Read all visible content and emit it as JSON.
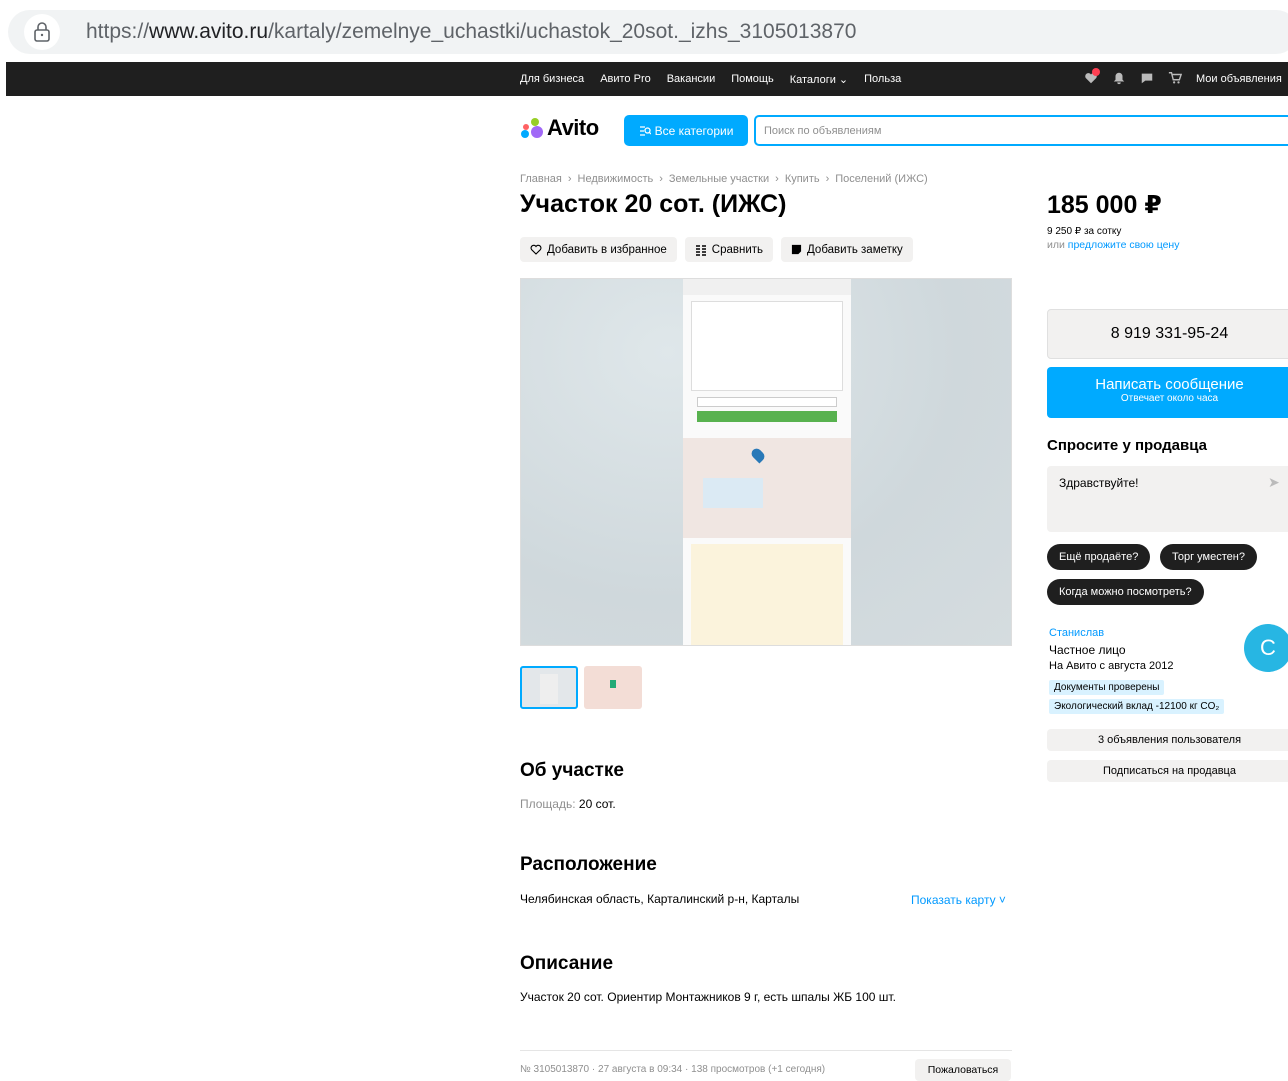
{
  "browser": {
    "url_prefix": "https://",
    "url_domain": "www.avito.ru",
    "url_path": "/kartaly/zemelnye_uchastki/uchastok_20sot._izhs_3105013870"
  },
  "topnav": {
    "items": [
      "Для бизнеса",
      "Авито Pro",
      "Вакансии",
      "Помощь",
      "Каталоги",
      "Польза"
    ],
    "my_ads": "Мои объявления"
  },
  "header": {
    "logo_text": "Avito",
    "all_categories": "Все категории",
    "search_placeholder": "Поиск по объявлениям"
  },
  "breadcrumb": [
    "Главная",
    "Недвижимость",
    "Земельные участки",
    "Купить",
    "Поселений (ИЖС)"
  ],
  "listing": {
    "title": "Участок 20 сот. (ИЖС)",
    "actions": {
      "favorite": "Добавить в избранное",
      "compare": "Сравнить",
      "note": "Добавить заметку"
    }
  },
  "about": {
    "heading": "Об участке",
    "area_label": "Площадь:",
    "area_value": "20 сот."
  },
  "location": {
    "heading": "Расположение",
    "address": "Челябинская область, Карталинский р-н, Карталы",
    "show_map": "Показать карту"
  },
  "description": {
    "heading": "Описание",
    "text": "Участок 20 сот. Ориентир Монтажников 9 г, есть шпалы ЖБ 100 шт."
  },
  "footer": {
    "meta": "№ 3105013870 · 27 августа в 09:34 · 138 просмотров (+1 сегодня)",
    "complain": "Пожаловаться"
  },
  "sidebar": {
    "price": "185 000 ₽",
    "per_sotka": "9 250 ₽ за сотку",
    "offer_prefix": "или",
    "offer_link": "предложите свою цену",
    "phone": "8 919 331-95-24",
    "message_button": "Написать сообщение",
    "message_sub": "Отвечает около часа",
    "ask_heading": "Спросите у продавца",
    "ask_text": "Здравствуйте!",
    "chips": [
      "Ещё продаёте?",
      "Торг уместен?",
      "Когда можно посмотреть?"
    ],
    "seller_name": "Станислав",
    "seller_type": "Частное лицо",
    "seller_since": "На Авито с августа 2012",
    "badge_docs": "Документы проверены",
    "badge_eco": "Экологический вклад -12100 кг CO₂",
    "avatar_letter": "С",
    "user_ads": "3 объявления пользователя",
    "subscribe": "Подписаться на продавца"
  }
}
